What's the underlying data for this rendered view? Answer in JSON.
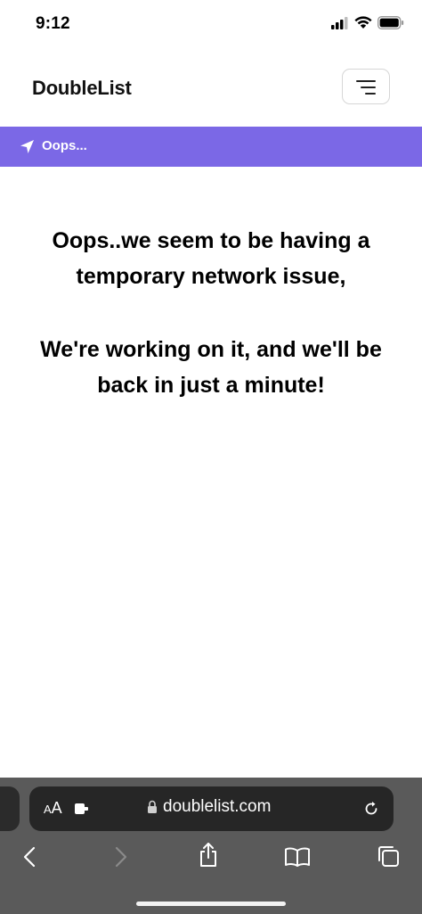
{
  "status_bar": {
    "time": "9:12",
    "icons": [
      "cellular-signal-icon",
      "wifi-icon",
      "battery-icon"
    ]
  },
  "header": {
    "logo_text": "DoubleList",
    "menu_icon": "hamburger-menu-icon"
  },
  "breadcrumb": {
    "icon": "location-arrow-icon",
    "label": "Oops..."
  },
  "message": {
    "lines_1": [
      "Oops..we seem to be having a",
      "temporary network issue,"
    ],
    "lines_2": [
      "We're working on it, and we'll be",
      "back in just a minute!"
    ]
  },
  "browser": {
    "text_size_label_small": "A",
    "text_size_label_large": "A",
    "url": "doublelist.com",
    "toolbar": [
      "back-icon",
      "forward-icon",
      "share-icon",
      "bookmarks-icon",
      "tabs-icon"
    ]
  },
  "colors": {
    "banner": "#7b68e6",
    "browser_bar": "#5a5a5a",
    "address_field": "#262626"
  }
}
